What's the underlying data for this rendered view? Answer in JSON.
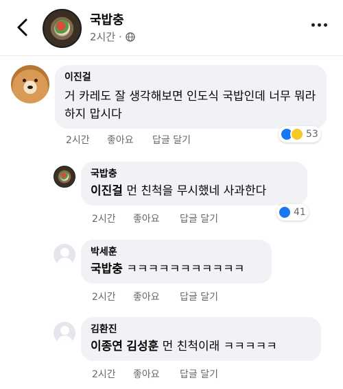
{
  "post": {
    "page_name": "국밥충",
    "time": "2시간",
    "separator": "·"
  },
  "comments": [
    {
      "author": "이진걸",
      "text": "거 카레도 잘 생각해보면 인도식 국밥인데 너무 뭐라 하지 맙시다",
      "time": "2시간",
      "like": "좋아요",
      "reply": "답글 달기",
      "reaction_count": "53",
      "reactions": [
        "like",
        "haha"
      ]
    }
  ],
  "replies": [
    {
      "author": "국밥충",
      "tag": "이진걸",
      "text": "먼 친척을 무시했네 사과한다",
      "time": "2시간",
      "like": "좋아요",
      "reply": "답글 달기",
      "reaction_count": "41",
      "reactions": [
        "like"
      ]
    },
    {
      "author": "박세훈",
      "tag": "국밥충",
      "text": "ㅋㅋㅋㅋㅋㅋㅋㅋㅋㅋㅋ",
      "time": "2시간",
      "like": "좋아요",
      "reply": "답글 달기"
    },
    {
      "author": "김환진",
      "tag": "이종연",
      "tag2": "김성훈",
      "text": "먼 친척이래 ㅋㅋㅋㅋㅋ",
      "time": "2시간",
      "like": "좋아요",
      "reply": "답글 달기"
    }
  ],
  "icons": {
    "back": "chevron-left-icon",
    "privacy": "globe-icon",
    "more": "more-horizontal-icon",
    "like": "like-reaction-icon",
    "haha": "haha-reaction-icon"
  },
  "colors": {
    "bubble": "#f0f2f5",
    "meta_text": "#65676b",
    "like_blue": "#1877f2",
    "haha_yellow": "#f7c928"
  }
}
